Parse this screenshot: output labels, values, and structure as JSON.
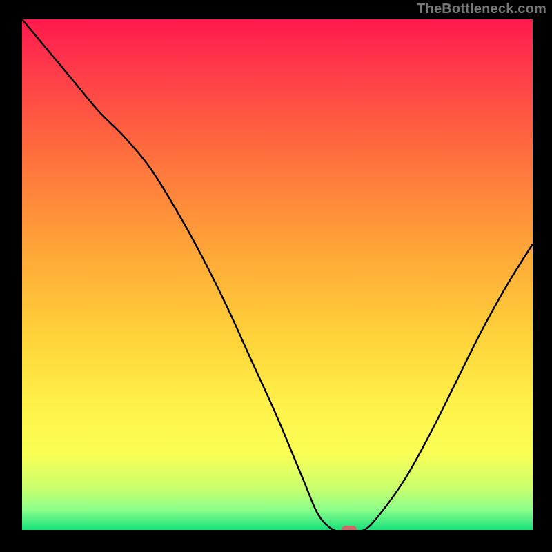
{
  "watermark": "TheBottleneck.com",
  "chart_data": {
    "type": "line",
    "title": "",
    "xlabel": "",
    "ylabel": "",
    "xlim": [
      0,
      100
    ],
    "ylim": [
      0,
      100
    ],
    "x": [
      0,
      5,
      10,
      15,
      20,
      25,
      30,
      35,
      40,
      45,
      50,
      55,
      58,
      61,
      64,
      67,
      70,
      75,
      80,
      85,
      90,
      95,
      100
    ],
    "y": [
      100,
      94,
      88,
      82,
      77,
      71,
      63,
      54,
      44,
      33,
      22,
      10,
      3,
      0,
      0,
      0,
      3,
      10,
      19,
      29,
      39,
      48,
      56
    ],
    "marker": {
      "x": 64,
      "y": 0
    },
    "colors": {
      "line": "#000000",
      "marker": "#cc6a6a",
      "gradient_top": "#ff1a4d",
      "gradient_bottom": "#18e07a"
    }
  }
}
